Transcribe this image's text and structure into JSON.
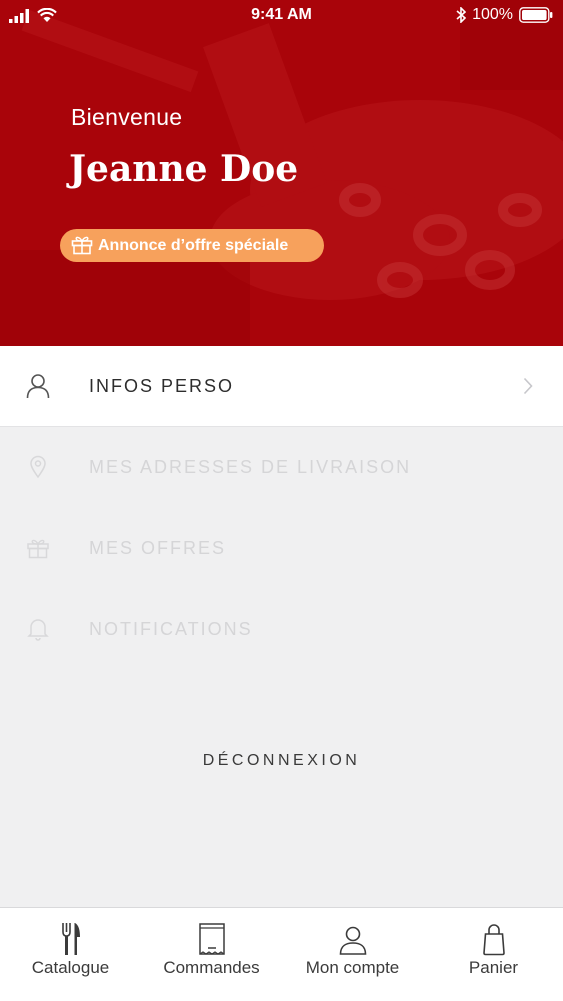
{
  "status_bar": {
    "time": "9:41 AM",
    "battery": "100%"
  },
  "hero": {
    "welcome": "Bienvenue",
    "user_name": "Jeanne Doe",
    "offer_label": "Annonce d’offre spéciale"
  },
  "menu": {
    "items": [
      {
        "label": "INFOS PERSO",
        "icon": "user-icon",
        "state": "active"
      },
      {
        "label": "MES ADRESSES DE LIVRAISON",
        "icon": "location-pin-icon",
        "state": "disabled"
      },
      {
        "label": "MES OFFRES",
        "icon": "gift-icon",
        "state": "disabled"
      },
      {
        "label": "NOTIFICATIONS",
        "icon": "bell-icon",
        "state": "disabled"
      }
    ],
    "logout_label": "DÉCONNEXION"
  },
  "tabbar": {
    "tabs": [
      {
        "label": "Catalogue",
        "icon": "fork-knife-icon"
      },
      {
        "label": "Commandes",
        "icon": "receipt-icon"
      },
      {
        "label": "Mon compte",
        "icon": "user-icon"
      },
      {
        "label": "Panier",
        "icon": "shopping-bag-icon"
      }
    ]
  },
  "colors": {
    "hero_red": "#a9040a",
    "offer_orange": "#f7a15c",
    "background": "#f0f0f1"
  }
}
